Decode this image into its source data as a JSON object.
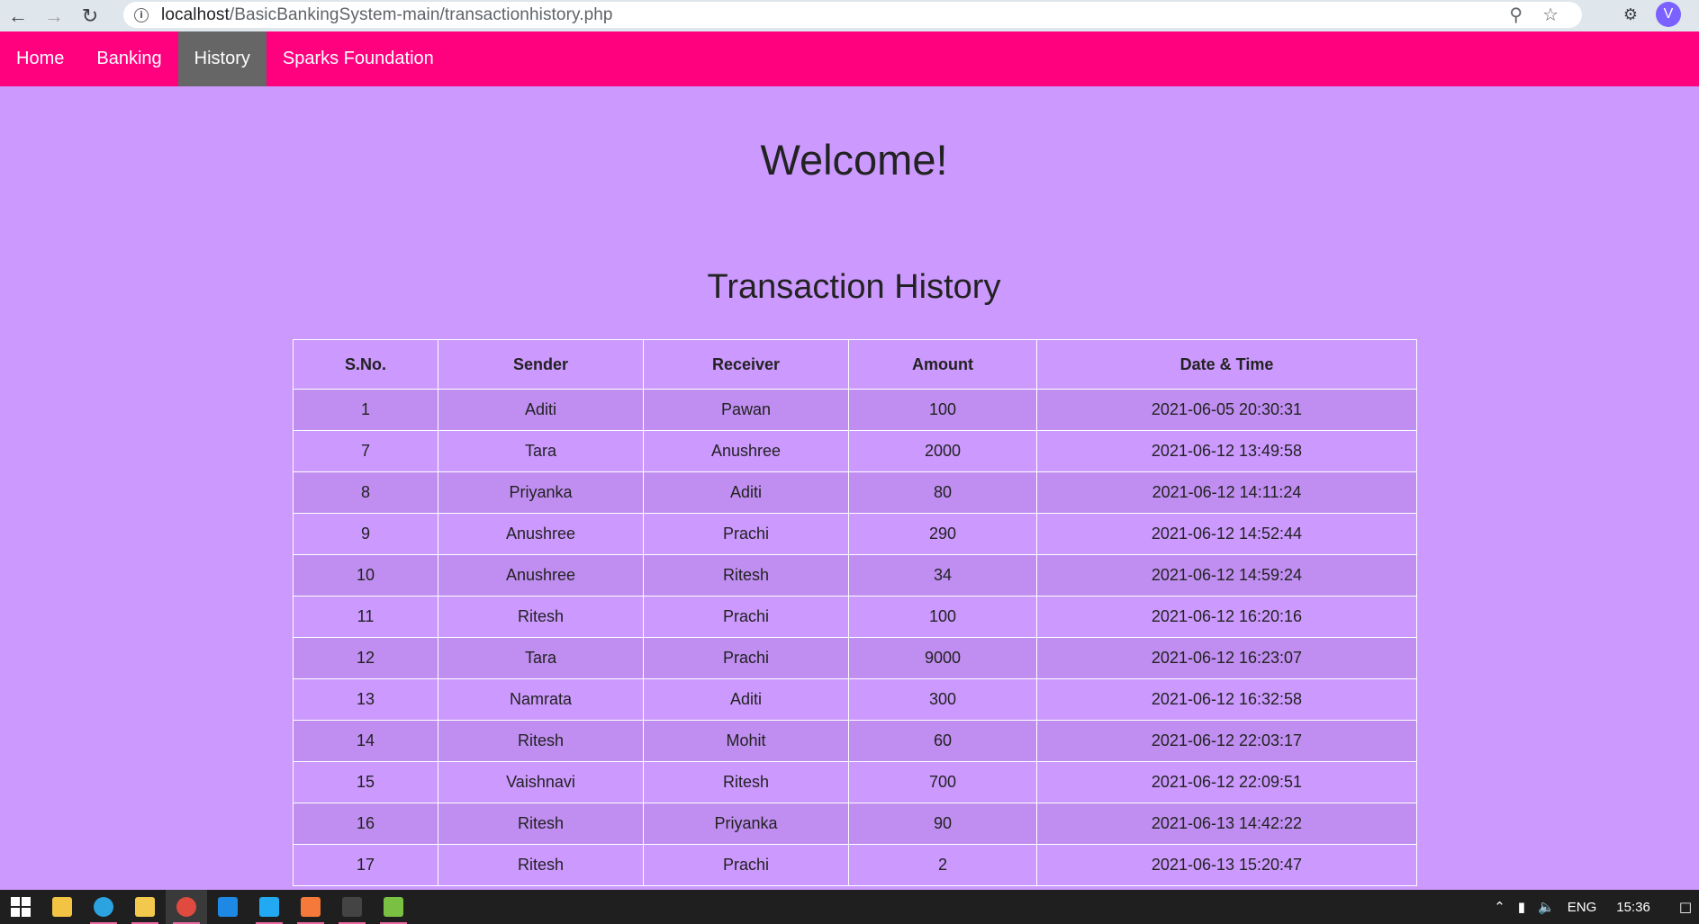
{
  "browser": {
    "url_host": "localhost",
    "url_path": "/BasicBankingSystem-main/transactionhistory.php",
    "avatar_letter": "V"
  },
  "nav": {
    "items": [
      {
        "label": "Home",
        "active": false
      },
      {
        "label": "Banking",
        "active": false
      },
      {
        "label": "History",
        "active": true
      },
      {
        "label": "Sparks Foundation",
        "active": false
      }
    ]
  },
  "page": {
    "welcome": "Welcome!",
    "title": "Transaction History"
  },
  "table": {
    "headers": [
      "S.No.",
      "Sender",
      "Receiver",
      "Amount",
      "Date & Time"
    ],
    "rows": [
      [
        "1",
        "Aditi",
        "Pawan",
        "100",
        "2021-06-05 20:30:31"
      ],
      [
        "7",
        "Tara",
        "Anushree",
        "2000",
        "2021-06-12 13:49:58"
      ],
      [
        "8",
        "Priyanka",
        "Aditi",
        "80",
        "2021-06-12 14:11:24"
      ],
      [
        "9",
        "Anushree",
        "Prachi",
        "290",
        "2021-06-12 14:52:44"
      ],
      [
        "10",
        "Anushree",
        "Ritesh",
        "34",
        "2021-06-12 14:59:24"
      ],
      [
        "11",
        "Ritesh",
        "Prachi",
        "100",
        "2021-06-12 16:20:16"
      ],
      [
        "12",
        "Tara",
        "Prachi",
        "9000",
        "2021-06-12 16:23:07"
      ],
      [
        "13",
        "Namrata",
        "Aditi",
        "300",
        "2021-06-12 16:32:58"
      ],
      [
        "14",
        "Ritesh",
        "Mohit",
        "60",
        "2021-06-12 22:03:17"
      ],
      [
        "15",
        "Vaishnavi",
        "Ritesh",
        "700",
        "2021-06-12 22:09:51"
      ],
      [
        "16",
        "Ritesh",
        "Priyanka",
        "90",
        "2021-06-13 14:42:22"
      ],
      [
        "17",
        "Ritesh",
        "Prachi",
        "2",
        "2021-06-13 15:20:47"
      ]
    ]
  },
  "taskbar": {
    "apps": [
      {
        "icon": "store-icon",
        "color": "#f3c344"
      },
      {
        "icon": "edge-icon",
        "color": "#2aa3e0"
      },
      {
        "icon": "file-explorer-icon",
        "color": "#f2c94c"
      },
      {
        "icon": "chrome-icon",
        "color": "#e04a3f"
      },
      {
        "icon": "mail-icon",
        "color": "#1e88e5"
      },
      {
        "icon": "vscode-icon",
        "color": "#23a9f2"
      },
      {
        "icon": "xampp-icon",
        "color": "#f5793a"
      },
      {
        "icon": "terminal-icon",
        "color": "#444444"
      },
      {
        "icon": "notepad-icon",
        "color": "#7ac143"
      }
    ],
    "lang": "ENG",
    "time": "15:36"
  },
  "colors": {
    "nav_bg": "#ff007f",
    "page_bg": "#cc99ff",
    "nav_active": "#666666"
  }
}
